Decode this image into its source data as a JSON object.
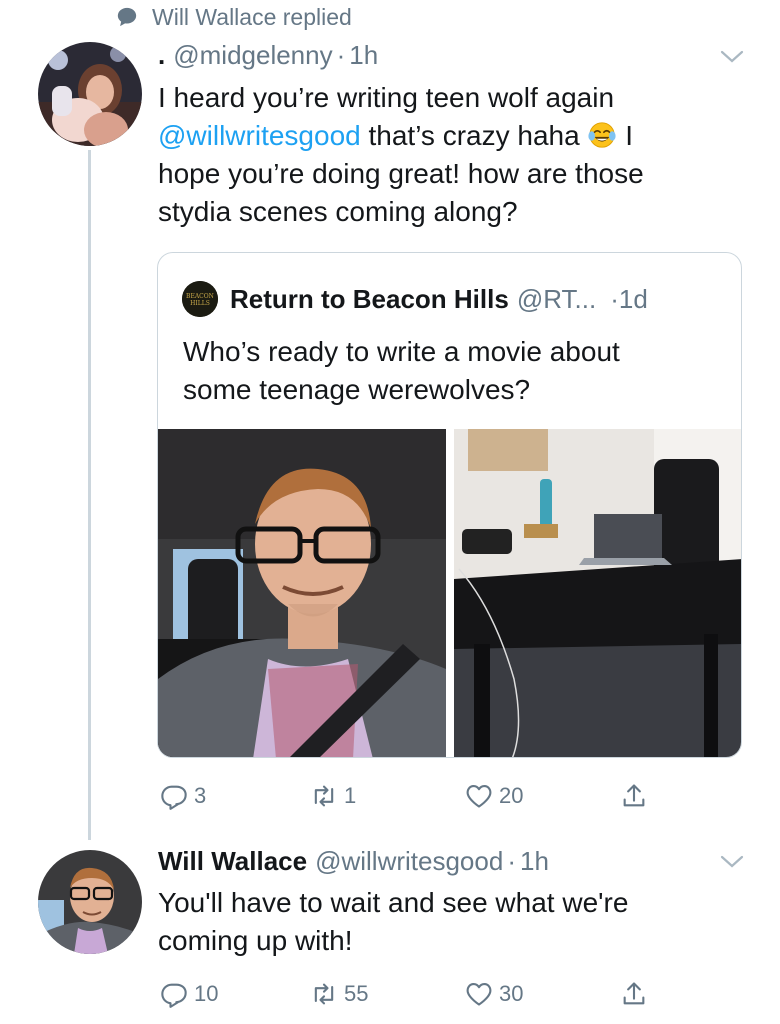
{
  "context": {
    "replied_label": "Will Wallace replied"
  },
  "tweet1": {
    "display_name": ".",
    "handle": "@midgelenny",
    "separator": "·",
    "time": "1h",
    "text_lines": [
      "I heard you’re writing teen wolf again"
    ],
    "mention": "@willwritesgood",
    "text_after_mention": " that’s crazy haha ",
    "text_after_emoji": " I",
    "text_line3": "hope you’re doing great! how are those",
    "text_line4": "stydia scenes coming along?",
    "emoji_icon": "face-with-tears-of-joy-icon"
  },
  "quote": {
    "name": "Return to Beacon Hills",
    "handle": "@RT...",
    "time": "·1d",
    "logo_text": "BEACON HILLS",
    "text_line1": "Who’s ready to write a movie about",
    "text_line2": "some teenage werewolves?"
  },
  "actions1": {
    "replies": "3",
    "retweets": "1",
    "likes": "20"
  },
  "tweet2": {
    "name": "Will Wallace",
    "handle": "@willwritesgood",
    "separator": "·",
    "time": "1h",
    "text_line1": "You'll have to wait and see what we're",
    "text_line2": "coming up with!"
  },
  "actions2": {
    "replies": "10",
    "retweets": "55",
    "likes": "30"
  },
  "colors": {
    "link": "#1da1f2",
    "secondary": "#657786",
    "border": "#ccd6dd",
    "text": "#14171a"
  }
}
